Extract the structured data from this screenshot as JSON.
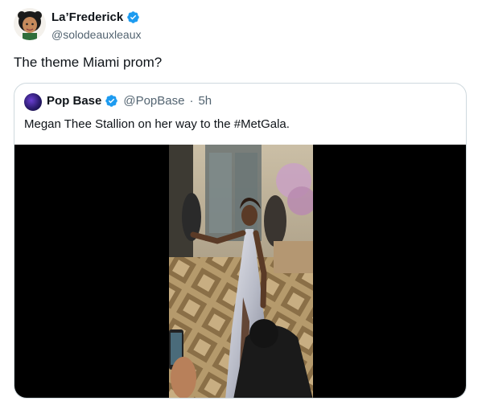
{
  "tweet": {
    "author_name": "La’Frederick",
    "author_handle": "@solodeauxleaux",
    "text": "The theme Miami prom?"
  },
  "quote": {
    "author_name": "Pop Base",
    "author_handle": "@PopBase",
    "separator": "·",
    "time": "5h",
    "text": "Megan Thee Stallion on her way to the #MetGala."
  },
  "colors": {
    "verified": "#1d9bf0",
    "text_primary": "#0f1419",
    "text_secondary": "#536471",
    "border": "#cfd9de"
  },
  "icons": {
    "verified": "verified-badge-icon"
  }
}
